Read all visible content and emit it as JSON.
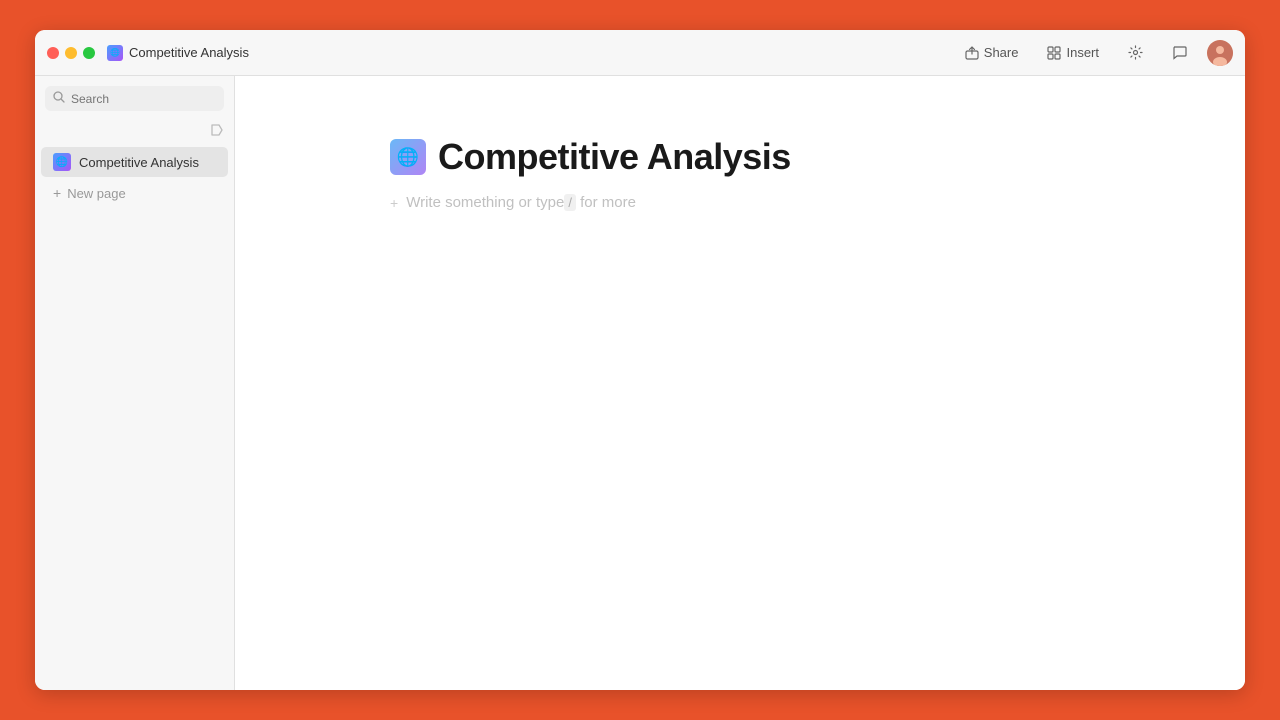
{
  "window": {
    "title": "Competitive Analysis"
  },
  "title_bar": {
    "page_title": "Competitive Analysis",
    "share_label": "Share",
    "insert_label": "Insert"
  },
  "sidebar": {
    "search_placeholder": "Search",
    "items": [
      {
        "id": "competitive-analysis",
        "label": "Competitive Analysis",
        "active": true
      }
    ],
    "new_page_label": "New page"
  },
  "editor": {
    "page_title": "Competitive Analysis",
    "placeholder_text": "Write something or type",
    "placeholder_slash": "/",
    "placeholder_suffix": " for more"
  },
  "icons": {
    "search": "🔍",
    "share": "⬆",
    "insert": "⊞",
    "settings": "⚙",
    "comment": "💬",
    "page_emoji": "🌐"
  }
}
